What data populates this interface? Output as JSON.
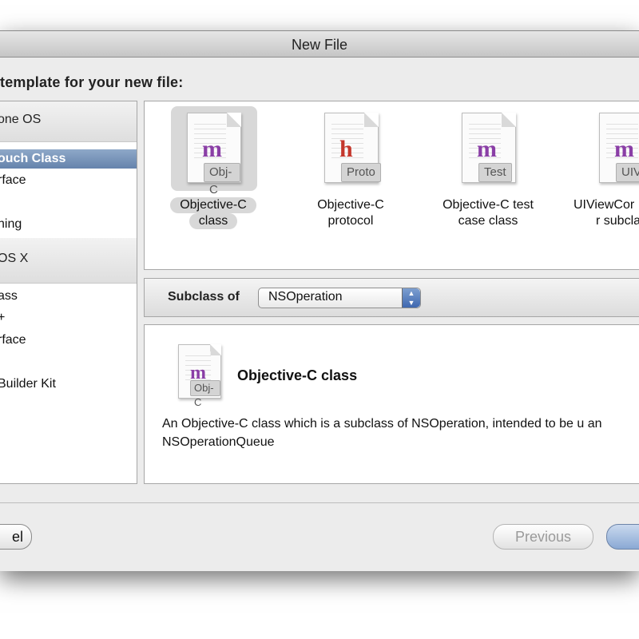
{
  "window": {
    "title": "New File"
  },
  "prompt": "template for your new file:",
  "sidebar": {
    "sections": [
      {
        "label": "one OS"
      },
      {
        "label": "OS X"
      }
    ],
    "items": [
      {
        "label": "ouch Class",
        "selected": true
      },
      {
        "label": "rface",
        "selected": false
      },
      {
        "label": "hing",
        "selected": false
      },
      {
        "label": "ass",
        "selected": false
      },
      {
        "label": "+",
        "selected": false
      },
      {
        "label": "rface",
        "selected": false
      },
      {
        "label": "Builder Kit",
        "selected": false
      }
    ]
  },
  "templates": [
    {
      "letter": "m",
      "badge": "Obj-C",
      "line1": "Objective-C",
      "line2": "class",
      "selected": true,
      "letter_color": "#8a3ea6",
      "icon": "document-icon"
    },
    {
      "letter": "h",
      "badge": "Proto",
      "line1": "Objective-C",
      "line2": "protocol",
      "selected": false,
      "letter_color": "#c4372c",
      "icon": "document-icon"
    },
    {
      "letter": "m",
      "badge": "Test",
      "line1": "Objective-C test",
      "line2": "case class",
      "selected": false,
      "letter_color": "#8a3ea6",
      "icon": "document-icon"
    },
    {
      "letter": "m",
      "badge": "UIV",
      "line1": "UIViewCor",
      "line2": "r subcla",
      "selected": false,
      "letter_color": "#8a3ea6",
      "icon": "document-icon"
    }
  ],
  "subclass": {
    "label": "Subclass of",
    "value": "NSOperation",
    "arrows": [
      "▲",
      "▼"
    ]
  },
  "description": {
    "title": "Objective-C class",
    "icon_letter": "m",
    "icon_badge": "Obj-C",
    "text": "An Objective-C class which is a subclass of NSOperation, intended to be u an NSOperationQueue"
  },
  "buttons": {
    "cancel": "el",
    "previous": "Previous",
    "next": ""
  },
  "colors": {
    "selection": "#6583ac",
    "window_bg": "#ececec"
  }
}
